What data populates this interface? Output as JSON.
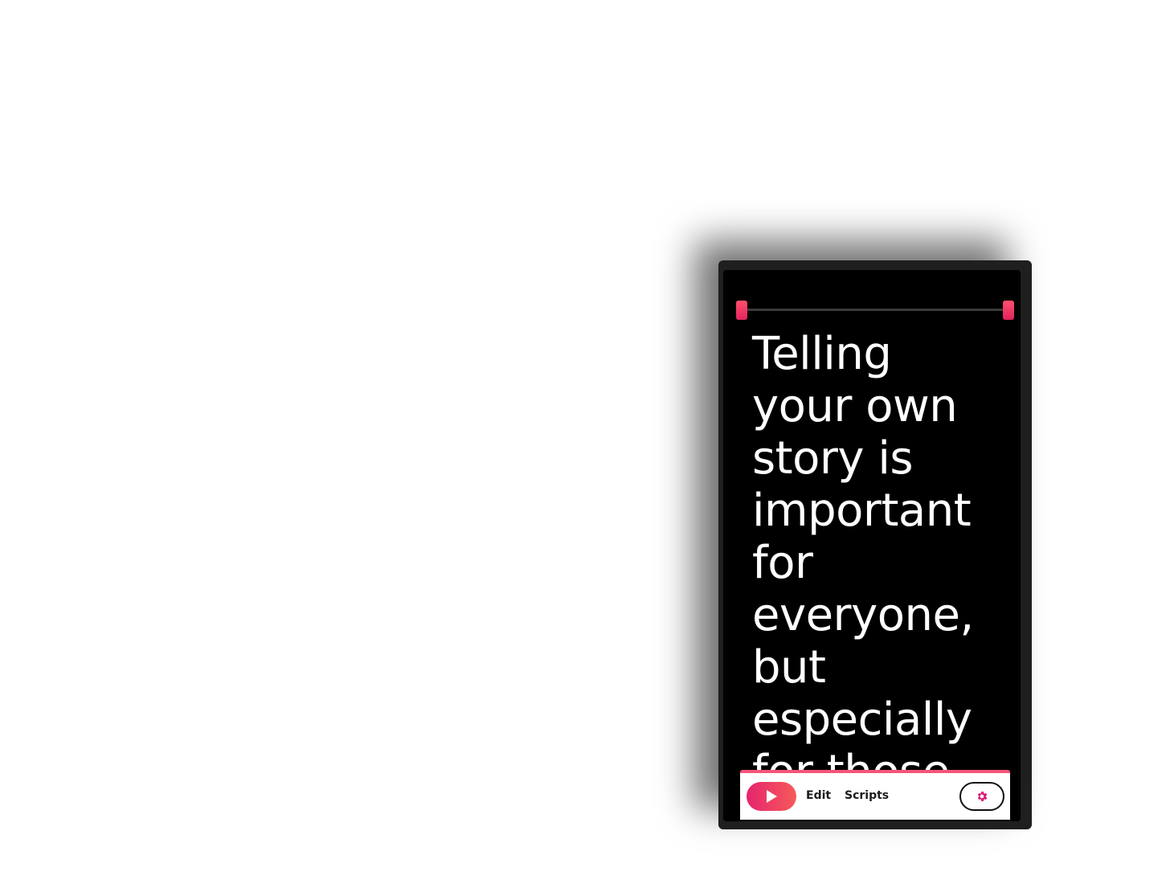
{
  "prompter": {
    "script_text": "Telling\nyour own\nstory is\nimportant\nfor\neveryone,\nbut\nespecially\nfor those"
  },
  "toolbar": {
    "play_icon": "play-icon",
    "edit_label": "Edit",
    "scripts_label": "Scripts",
    "settings_icon": "gear-icon"
  },
  "colors": {
    "accent_start": "#e6246e",
    "accent_end": "#f65a5a",
    "screen_bg": "#000000",
    "device_frame": "#1f1f1f",
    "settings_icon": "#d81b7a"
  }
}
